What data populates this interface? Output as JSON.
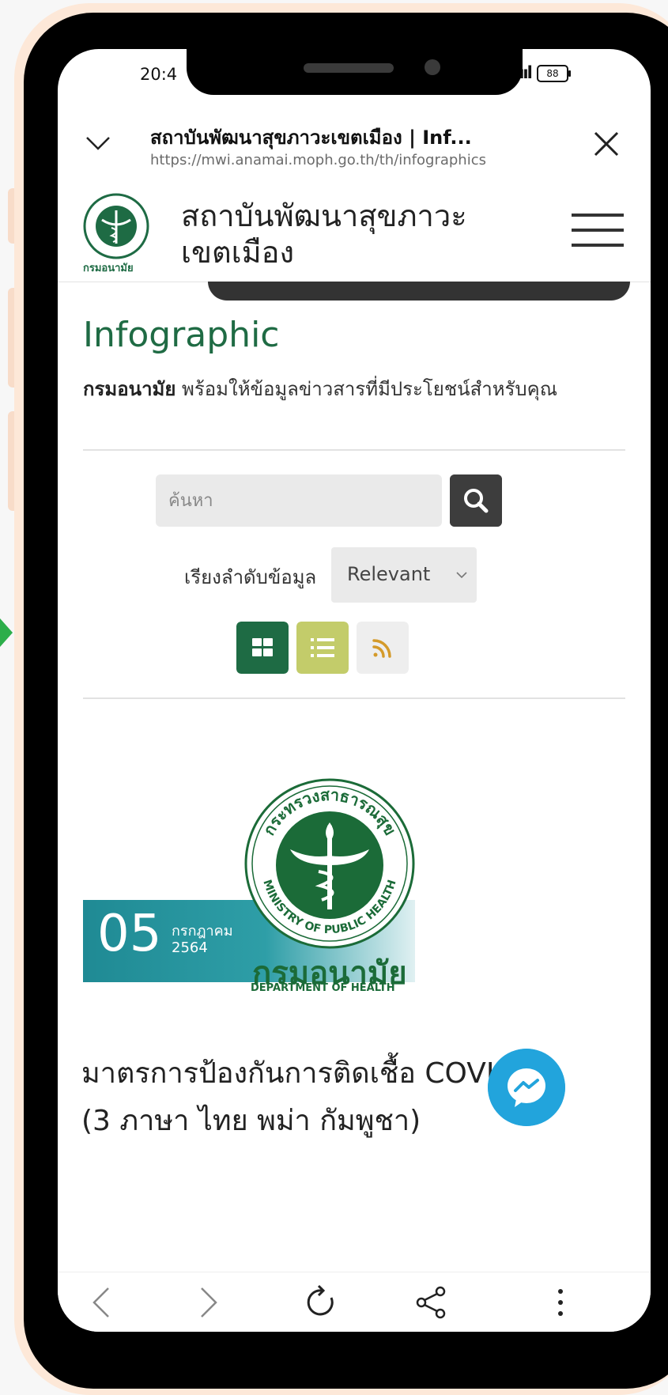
{
  "status_bar": {
    "time": "20:4",
    "signal": "ıııl",
    "battery": "88"
  },
  "browser": {
    "tab_title": "สถาบันพัฒนาสุขภาวะเขตเมือง | Inf...",
    "url": "https://mwi.anamai.moph.go.th/th/infographics"
  },
  "site": {
    "title_line1": "สถาบันพัฒนาสุขภาวะ",
    "title_line2": "เขตเมือง",
    "logo_text": "กรมอนามัย"
  },
  "page": {
    "heading": "Infographic",
    "tagline_bold": "กรมอนามัย",
    "tagline_rest": " พร้อมให้ข้อมูลข่าวสารที่มีประโยชน์สำหรับคุณ"
  },
  "search": {
    "placeholder": "ค้นหา",
    "value": ""
  },
  "sort": {
    "label": "เรียงลำดับข้อมูล",
    "selected": "Relevant"
  },
  "view_buttons": [
    {
      "name": "grid-view",
      "color": "#1e6b44"
    },
    {
      "name": "list-view",
      "color": "#c3cc6a"
    },
    {
      "name": "rss",
      "color": "#eeeeee"
    }
  ],
  "article": {
    "date_day": "05",
    "date_month": "กรกฎาคม",
    "date_year": "2564",
    "seal_title": "กรมอนามัย",
    "seal_subtitle": "DEPARTMENT OF HEALTH",
    "seal_ring_top": "กระทรวงสาธารณสุข",
    "seal_ring_bottom": "MINISTRY OF PUBLIC HEALTH",
    "title_line1": "มาตรการป้องกันการติดเชื้อ COVI",
    "title_line2": "(3 ภาษา ไทย พม่า กัมพูชา)"
  },
  "colors": {
    "brand_green": "#1f6b44",
    "messenger_blue": "#22a4dc",
    "badge_teal": "#1f8a94"
  }
}
